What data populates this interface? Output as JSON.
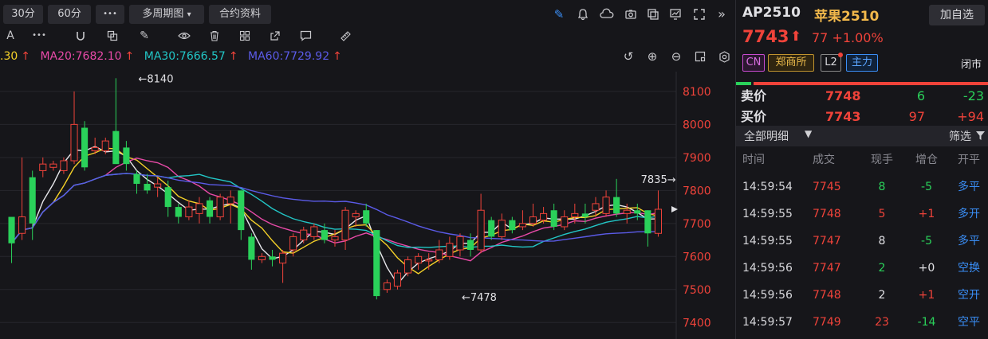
{
  "toolbar": {
    "period_30": "30分",
    "period_60": "60分",
    "more": "•••",
    "multi_period": "多周期图",
    "contract_info": "合约资料"
  },
  "toolbar_icons": [
    "pencil-icon",
    "bell-icon",
    "cloud-icon",
    "camera-icon",
    "copy-window-icon",
    "monitor-chart-icon",
    "fullscreen-icon",
    "collapse-right-icon"
  ],
  "drawing_tools": {
    "text_tool": "A",
    "more": "•••"
  },
  "ma_legend": {
    "ma10_fragment": ".30",
    "ma20": "MA20:7682.10",
    "ma30": "MA30:7666.57",
    "ma60": "MA60:7729.92",
    "arrow": "↑"
  },
  "colors": {
    "up": "#f0433a",
    "down": "#2ad15a",
    "ma5": "#e8e8ec",
    "ma10": "#f5d128",
    "ma20": "#e84aa8",
    "ma30": "#22c6c6",
    "ma60": "#5b5be8",
    "accent": "#3a8ef6",
    "exchange": "#e8b84a"
  },
  "chart_data": {
    "type": "candlestick",
    "y_ticks": [
      "8100",
      "8000",
      "7900",
      "7800",
      "7700",
      "7600",
      "7500",
      "7400"
    ],
    "ylim": [
      7350,
      8160
    ],
    "annotations": [
      {
        "label": "←8140",
        "value": 8140,
        "bar": 12
      },
      {
        "label": "7835→",
        "value": 7835,
        "bar": 64
      },
      {
        "label": "←7478",
        "value": 7478,
        "bar": 43
      }
    ],
    "current_marker": 7743,
    "candles": [
      [
        7720,
        7640,
        7690,
        7580
      ],
      [
        7670,
        7720,
        7900,
        7650
      ],
      [
        7840,
        7700,
        7860,
        7650
      ],
      [
        7860,
        7880,
        7900,
        7840
      ],
      [
        7870,
        7880,
        7890,
        7860
      ],
      [
        7860,
        7890,
        7900,
        7850
      ],
      [
        7890,
        8000,
        8100,
        7880
      ],
      [
        7990,
        7870,
        8010,
        7860
      ],
      [
        7920,
        7930,
        7960,
        7910
      ],
      [
        7920,
        7950,
        7960,
        7910
      ],
      [
        7980,
        7880,
        8140,
        7880
      ],
      [
        7930,
        7880,
        7950,
        7860
      ],
      [
        7850,
        7820,
        7860,
        7790
      ],
      [
        7820,
        7800,
        7850,
        7790
      ],
      [
        7810,
        7820,
        7840,
        7780
      ],
      [
        7810,
        7750,
        7830,
        7720
      ],
      [
        7750,
        7720,
        7760,
        7700
      ],
      [
        7720,
        7750,
        7770,
        7710
      ],
      [
        7730,
        7760,
        7780,
        7700
      ],
      [
        7770,
        7720,
        7780,
        7700
      ],
      [
        7720,
        7780,
        7790,
        7710
      ],
      [
        7760,
        7780,
        7800,
        7700
      ],
      [
        7800,
        7680,
        7800,
        7650
      ],
      [
        7660,
        7590,
        7670,
        7560
      ],
      [
        7590,
        7600,
        7610,
        7580
      ],
      [
        7600,
        7590,
        7620,
        7570
      ],
      [
        7580,
        7610,
        7620,
        7520
      ],
      [
        7620,
        7660,
        7670,
        7600
      ],
      [
        7650,
        7680,
        7690,
        7640
      ],
      [
        7660,
        7690,
        7700,
        7650
      ],
      [
        7680,
        7650,
        7700,
        7640
      ],
      [
        7650,
        7660,
        7680,
        7630
      ],
      [
        7650,
        7740,
        7750,
        7620
      ],
      [
        7720,
        7730,
        7740,
        7690
      ],
      [
        7740,
        7700,
        7760,
        7690
      ],
      [
        7680,
        7480,
        7680,
        7470
      ],
      [
        7500,
        7520,
        7530,
        7490
      ],
      [
        7510,
        7550,
        7560,
        7500
      ],
      [
        7550,
        7590,
        7600,
        7540
      ],
      [
        7580,
        7600,
        7610,
        7560
      ],
      [
        7590,
        7590,
        7610,
        7560
      ],
      [
        7590,
        7620,
        7650,
        7580
      ],
      [
        7600,
        7640,
        7660,
        7590
      ],
      [
        7620,
        7660,
        7670,
        7600
      ],
      [
        7650,
        7620,
        7670,
        7600
      ],
      [
        7620,
        7740,
        7790,
        7610
      ],
      [
        7710,
        7660,
        7720,
        7650
      ],
      [
        7660,
        7710,
        7730,
        7650
      ],
      [
        7710,
        7680,
        7720,
        7670
      ],
      [
        7690,
        7700,
        7740,
        7680
      ],
      [
        7700,
        7720,
        7760,
        7690
      ],
      [
        7710,
        7730,
        7750,
        7700
      ],
      [
        7740,
        7690,
        7760,
        7680
      ],
      [
        7690,
        7720,
        7740,
        7680
      ],
      [
        7720,
        7730,
        7760,
        7700
      ],
      [
        7730,
        7720,
        7760,
        7700
      ],
      [
        7740,
        7760,
        7780,
        7720
      ],
      [
        7730,
        7780,
        7800,
        7720
      ],
      [
        7780,
        7730,
        7835,
        7720
      ],
      [
        7730,
        7740,
        7760,
        7700
      ],
      [
        7740,
        7730,
        7760,
        7710
      ],
      [
        7740,
        7670,
        7740,
        7630
      ],
      [
        7670,
        7743,
        7800,
        7660
      ]
    ]
  },
  "symbol": {
    "code": "AP2510",
    "name": "苹果2510",
    "add_watch": "加自选",
    "last_price": "7743",
    "up_arrow": "⬆",
    "change": "77  +1.00%",
    "tags": {
      "cn": "CN",
      "exchange": "郑商所",
      "l2": "L2",
      "main": "主力"
    },
    "status": "闭市",
    "bid_ratio": 0.06
  },
  "order_book": [
    {
      "label": "卖价",
      "price": "7748",
      "vol": "6",
      "chg": "-23",
      "vol_color": "#2ad15a",
      "chg_color": "#2ad15a"
    },
    {
      "label": "买价",
      "price": "7743",
      "vol": "97",
      "chg": "+94",
      "vol_color": "#f0433a",
      "chg_color": "#f0433a"
    }
  ],
  "detail": {
    "title": "全部明细",
    "caret": "▼",
    "filter": "筛选",
    "headers": {
      "time": "时间",
      "price": "成交",
      "qty": "现手",
      "oi": "增仓",
      "type": "开平"
    }
  },
  "ticks": [
    {
      "time": "14:59:54",
      "price": "7745",
      "qty": "8",
      "oi": "-5",
      "type": "多平",
      "qty_color": "#2ad15a",
      "oi_color": "#2ad15a",
      "type_color": "#3a8ef6"
    },
    {
      "time": "14:59:55",
      "price": "7748",
      "qty": "5",
      "oi": "+1",
      "type": "多开",
      "qty_color": "#f0433a",
      "oi_color": "#f0433a",
      "type_color": "#3a8ef6"
    },
    {
      "time": "14:59:55",
      "price": "7747",
      "qty": "8",
      "oi": "-5",
      "type": "多平",
      "qty_color": "#e0e0e4",
      "oi_color": "#2ad15a",
      "type_color": "#3a8ef6"
    },
    {
      "time": "14:59:56",
      "price": "7747",
      "qty": "2",
      "oi": "+0",
      "type": "空换",
      "qty_color": "#2ad15a",
      "oi_color": "#e0e0e4",
      "type_color": "#3a8ef6"
    },
    {
      "time": "14:59:56",
      "price": "7748",
      "qty": "2",
      "oi": "+1",
      "type": "空开",
      "qty_color": "#e0e0e4",
      "oi_color": "#f0433a",
      "type_color": "#3a8ef6"
    },
    {
      "time": "14:59:57",
      "price": "7749",
      "qty": "23",
      "oi": "-14",
      "type": "空平",
      "qty_color": "#f0433a",
      "oi_color": "#2ad15a",
      "type_color": "#3a8ef6"
    }
  ]
}
